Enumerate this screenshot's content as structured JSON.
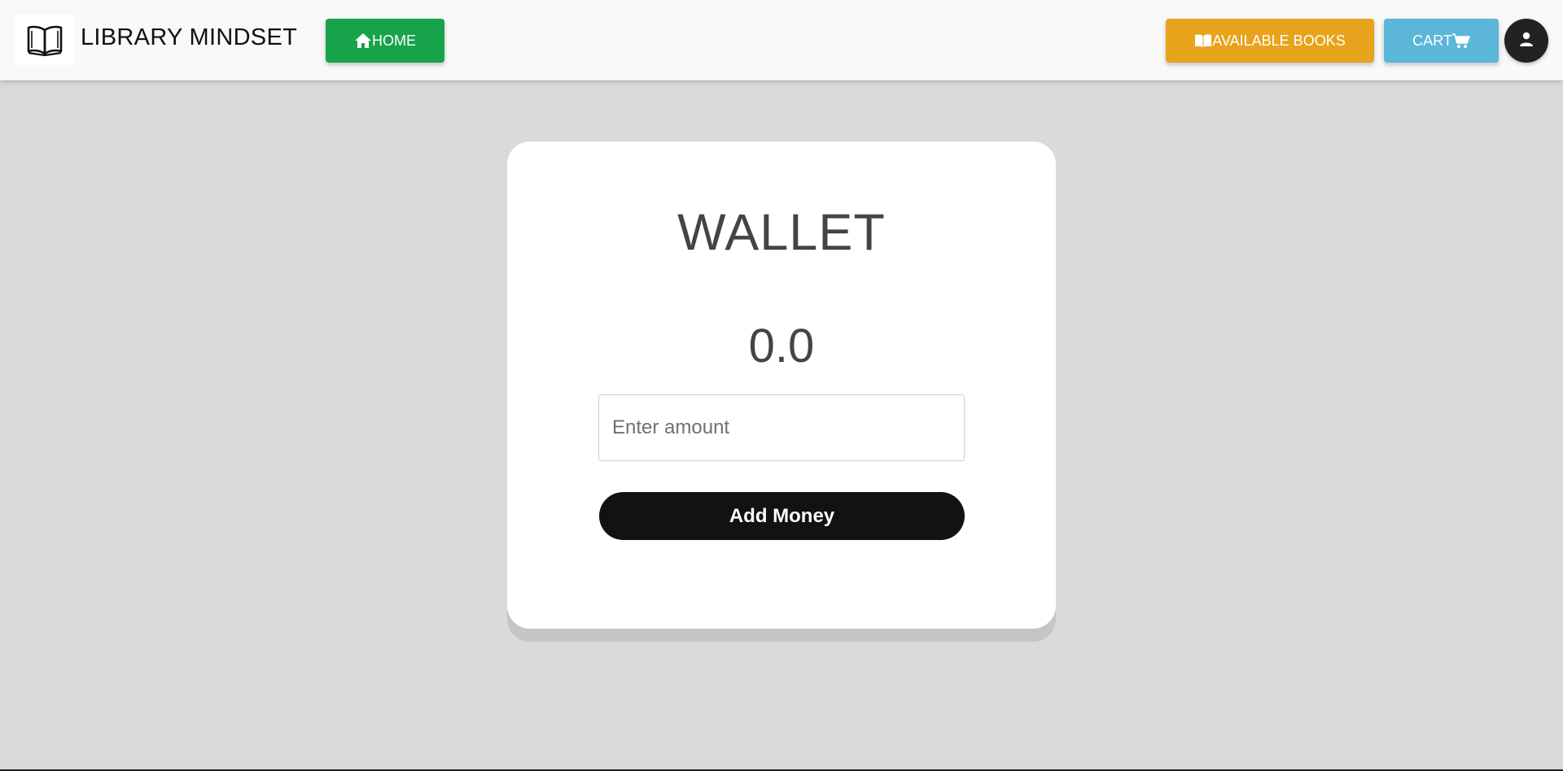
{
  "navbar": {
    "brand": "LIBRARY MINDSET",
    "logo_icon": "open-book-icon",
    "home_label": "HOME",
    "home_icon": "home-icon",
    "books_label": "AVAILABLE BOOKS",
    "books_icon": "book-open-icon",
    "cart_label": "CART",
    "cart_icon": "shopping-cart-icon",
    "avatar_icon": "user-icon"
  },
  "wallet": {
    "title": "WALLET",
    "balance": "0.0",
    "amount_placeholder": "Enter amount",
    "amount_value": "",
    "add_label": "Add Money"
  },
  "colors": {
    "page_bg": "#dbd9da",
    "home": "#16a34a",
    "books": "#e8a31c",
    "cart": "#5bb6d8",
    "add_button": "#121212"
  }
}
